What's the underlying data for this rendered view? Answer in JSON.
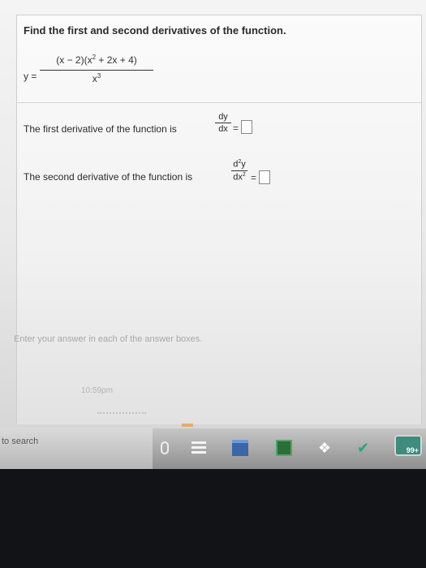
{
  "question": {
    "prompt": "Find the first and second derivatives of the function.",
    "function_lhs": "y =",
    "numerator": "(x − 2)(x",
    "numerator_exp": "2",
    "numerator_rest": " + 2x + 4)",
    "denominator": "x",
    "denominator_exp": "3"
  },
  "first_derivative": {
    "label": "The first derivative of the function is",
    "num": "dy",
    "den": "dx",
    "equals": "="
  },
  "second_derivative": {
    "label": "The second derivative of the function is",
    "num": "d",
    "num_exp": "2",
    "num_var": "y",
    "den": "dx",
    "den_exp": "2",
    "equals": "="
  },
  "hint": "Enter your answer in each of the answer boxes.",
  "timestamp": "10:59pm",
  "taskbar": {
    "search_placeholder": "to search",
    "badge": "99+",
    "icons": [
      "microphone-icon",
      "task-view-icon",
      "file-explorer-icon",
      "store-icon",
      "dropbox-icon",
      "chat-icon"
    ]
  }
}
